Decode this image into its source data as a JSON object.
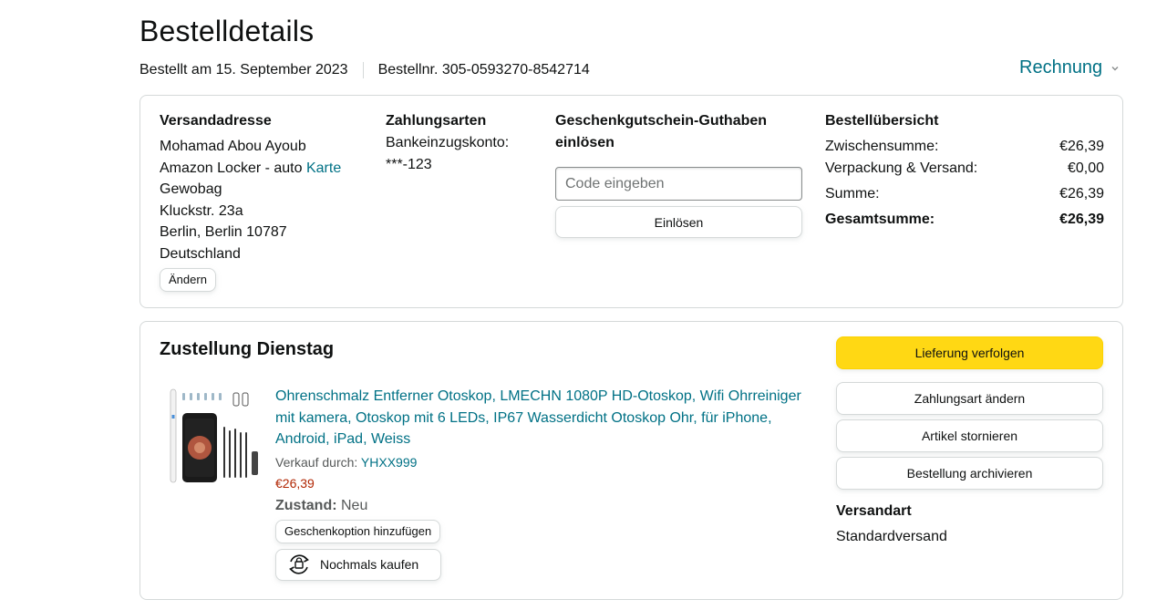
{
  "header": {
    "title": "Bestelldetails",
    "ordered_on": "Bestellt am 15. September 2023",
    "order_number": "Bestellnr. 305-0593270-8542714",
    "invoice_label": "Rechnung"
  },
  "address": {
    "heading": "Versandadresse",
    "name": "Mohamad Abou Ayoub",
    "line1_text": "Amazon Locker - auto ",
    "line1_link": "Karte",
    "line2": "Gewobag",
    "line3": "Kluckstr. 23a",
    "line4": "Berlin, Berlin 10787",
    "line5": "Deutschland",
    "change_label": "Ändern"
  },
  "payment": {
    "heading": "Zahlungsarten",
    "method": "Bankeinzugskonto:",
    "account": "***-123"
  },
  "gift": {
    "heading": "Geschenkgutschein-Guthaben einlösen",
    "placeholder": "Code eingeben",
    "redeem_label": "Einlösen"
  },
  "summary": {
    "heading": "Bestellübersicht",
    "rows": [
      {
        "label": "Zwischensumme:",
        "value": "€26,39"
      },
      {
        "label": "Verpackung & Versand:",
        "value": "€0,00"
      },
      {
        "label": "Summe:",
        "value": "€26,39"
      },
      {
        "label": "Gesamtsumme:",
        "value": "€26,39"
      }
    ]
  },
  "delivery": {
    "title": "Zustellung Dienstag",
    "product": {
      "title": "Ohrenschmalz Entferner Otoskop, LMECHN 1080P HD-Otoskop, Wifi Ohrreiniger mit kamera, Otoskop mit 6 LEDs, IP67 Wasserdicht Otoskop Ohr, für iPhone, Android, iPad, Weiss",
      "sold_by_label": "Verkauf durch: ",
      "seller": "YHXX999",
      "price": "€26,39",
      "condition_label": "Zustand:",
      "condition_value": " Neu",
      "gift_option_label": "Geschenkoption hinzufügen",
      "rebuy_label": "Nochmals kaufen"
    },
    "actions": {
      "track": "Lieferung verfolgen",
      "change_payment": "Zahlungsart ändern",
      "cancel": "Artikel stornieren",
      "archive": "Bestellung archivieren"
    },
    "shipping_label": "Versandart",
    "shipping_value": "Standardversand"
  },
  "colors": {
    "link": "#007185",
    "price": "#B12704",
    "primary_button": "#FFD814",
    "border": "#D5D9D9"
  }
}
